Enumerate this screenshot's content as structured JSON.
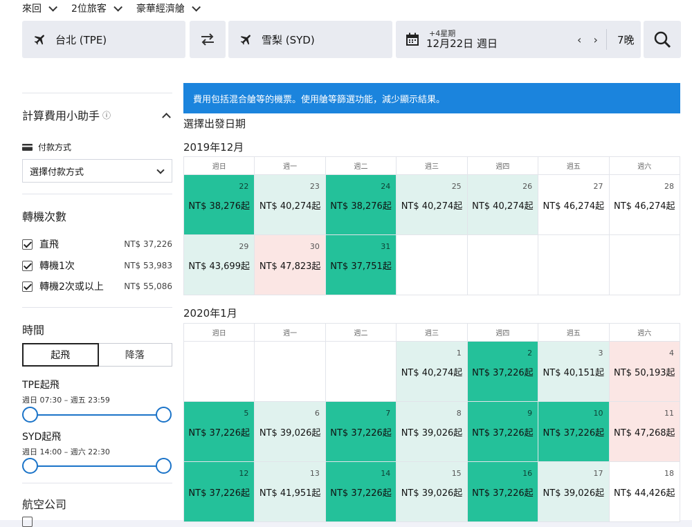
{
  "header": {
    "trip_type": "來回",
    "travelers": "2位旅客",
    "cabin": "豪華經濟艙",
    "origin": "台北 (TPE)",
    "destination": "雪梨 (SYD)",
    "date_offset": "+4星期",
    "date": "12月22日 週日",
    "prev_arrow": "‹",
    "next_arrow": "›",
    "nights": "7晚"
  },
  "sidebar": {
    "calc_title": "計算費用小助手",
    "info_icon": "ⓘ",
    "payment_label": "付款方式",
    "payment_select": "選擇付款方式",
    "stops_title": "轉機次數",
    "stops": [
      {
        "label": "直飛",
        "price": "NT$ 37,226"
      },
      {
        "label": "轉機1次",
        "price": "NT$ 53,983"
      },
      {
        "label": "轉機2次或以上",
        "price": "NT$ 55,086"
      }
    ],
    "time_title": "時間",
    "tab_depart": "起飛",
    "tab_land": "降落",
    "tpe_label": "TPE起飛",
    "tpe_range": "週日 07:30 – 週五 23:59",
    "syd_label": "SYD起飛",
    "syd_range": "週日 14:00 – 週六 22:30",
    "airline_title": "航空公司"
  },
  "main": {
    "banner": "費用包括混合艙等的機票。使用艙等篩選功能，減少顯示結果。",
    "select_title": "選擇出發日期",
    "weekdays": [
      "週日",
      "週一",
      "週二",
      "週三",
      "週四",
      "週五",
      "週六"
    ],
    "month1": {
      "label": "2019年12月",
      "rows": [
        [
          {
            "d": "22",
            "p": "NT$ 38,276起",
            "c": "g"
          },
          {
            "d": "23",
            "p": "NT$ 40,274起",
            "c": "l"
          },
          {
            "d": "24",
            "p": "NT$ 38,276起",
            "c": "g"
          },
          {
            "d": "25",
            "p": "NT$ 40,274起",
            "c": "l"
          },
          {
            "d": "26",
            "p": "NT$ 40,274起",
            "c": "l"
          },
          {
            "d": "27",
            "p": "NT$ 46,274起",
            "c": "w"
          },
          {
            "d": "28",
            "p": "NT$ 46,274起",
            "c": "w"
          }
        ],
        [
          {
            "d": "29",
            "p": "NT$ 43,699起",
            "c": "l"
          },
          {
            "d": "30",
            "p": "NT$ 47,823起",
            "c": "r"
          },
          {
            "d": "31",
            "p": "NT$ 37,751起",
            "c": "g"
          },
          {
            "d": "",
            "p": "",
            "c": "w"
          },
          {
            "d": "",
            "p": "",
            "c": "w"
          },
          {
            "d": "",
            "p": "",
            "c": "w"
          },
          {
            "d": "",
            "p": "",
            "c": "w"
          }
        ]
      ]
    },
    "month2": {
      "label": "2020年1月",
      "rows": [
        [
          {
            "d": "",
            "p": "",
            "c": "w"
          },
          {
            "d": "",
            "p": "",
            "c": "w"
          },
          {
            "d": "",
            "p": "",
            "c": "w"
          },
          {
            "d": "1",
            "p": "NT$ 40,274起",
            "c": "l"
          },
          {
            "d": "2",
            "p": "NT$ 37,226起",
            "c": "g"
          },
          {
            "d": "3",
            "p": "NT$ 40,151起",
            "c": "l"
          },
          {
            "d": "4",
            "p": "NT$ 50,193起",
            "c": "r"
          }
        ],
        [
          {
            "d": "5",
            "p": "NT$ 37,226起",
            "c": "g"
          },
          {
            "d": "6",
            "p": "NT$ 39,026起",
            "c": "l"
          },
          {
            "d": "7",
            "p": "NT$ 37,226起",
            "c": "g"
          },
          {
            "d": "8",
            "p": "NT$ 39,026起",
            "c": "l"
          },
          {
            "d": "9",
            "p": "NT$ 37,226起",
            "c": "g"
          },
          {
            "d": "10",
            "p": "NT$ 37,226起",
            "c": "g"
          },
          {
            "d": "11",
            "p": "NT$ 47,268起",
            "c": "r"
          }
        ],
        [
          {
            "d": "12",
            "p": "NT$ 37,226起",
            "c": "g"
          },
          {
            "d": "13",
            "p": "NT$ 41,951起",
            "c": "l"
          },
          {
            "d": "14",
            "p": "NT$ 37,226起",
            "c": "g"
          },
          {
            "d": "15",
            "p": "NT$ 39,026起",
            "c": "l"
          },
          {
            "d": "16",
            "p": "NT$ 37,226起",
            "c": "g"
          },
          {
            "d": "17",
            "p": "NT$ 39,026起",
            "c": "l"
          },
          {
            "d": "18",
            "p": "NT$ 44,426起",
            "c": "w"
          }
        ]
      ]
    }
  },
  "colors": {
    "cheapest": "#24c19a",
    "cheap": "#e0f2ee",
    "expensive": "#fbe6e4",
    "accent": "#1b84dd"
  }
}
